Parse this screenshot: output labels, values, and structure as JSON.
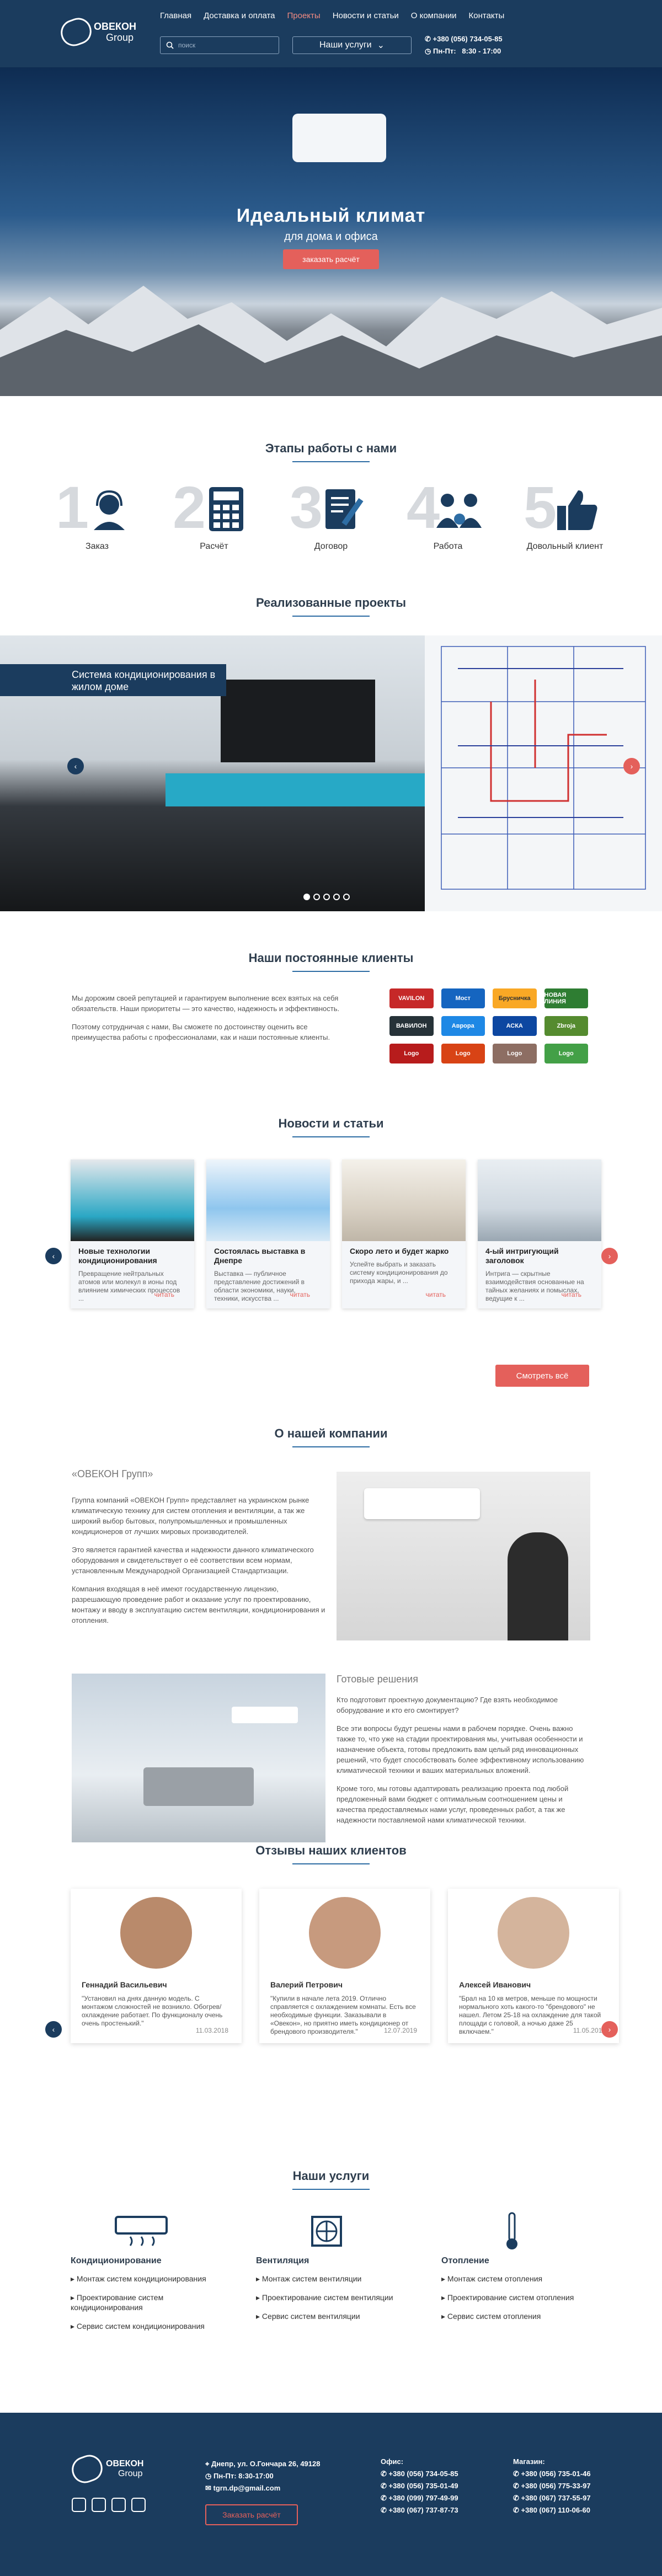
{
  "brand": {
    "name": "ОВЕКОН",
    "sub": "Group"
  },
  "nav": [
    "Главная",
    "Доставка и оплата",
    "Проекты",
    "Новости и статьи",
    "О компании",
    "Контакты"
  ],
  "nav_active": 2,
  "search": {
    "placeholder": "поиск"
  },
  "services_button": "Наши услуги",
  "contacts": {
    "phone": "+380 (056) 734-05-85",
    "hours_label": "Пн-Пт:",
    "hours": "8:30 - 17:00"
  },
  "hero": {
    "title": "Идеальный климат",
    "subtitle": "для дома и офиса",
    "cta": "заказать расчёт"
  },
  "stages": {
    "title": "Этапы работы с нами",
    "items": [
      {
        "num": "1",
        "label": "Заказ"
      },
      {
        "num": "2",
        "label": "Расчёт"
      },
      {
        "num": "3",
        "label": "Договор"
      },
      {
        "num": "4",
        "label": "Работа"
      },
      {
        "num": "5",
        "label": "Довольный клиент"
      }
    ]
  },
  "projects": {
    "title": "Реализованные проекты",
    "caption": "Система кондиционирования в жилом доме"
  },
  "clients": {
    "title": "Наши постоянные клиенты",
    "text1": "Мы дорожим своей репутацией и гарантируем выполнение всех взятых на себя обязательств. Наши приоритеты — это качество, надежность и эффективность.",
    "text2": "Поэтому сотрудничая с нами, Вы сможете по достоинству оценить все преимущества работы с профессионалами, как и наши постоянные клиенты.",
    "logos": [
      "VAVILON",
      "Мост",
      "Брусничка",
      "НОВАЯ ЛИНИЯ",
      "ВАВИЛОН",
      "Аврора",
      "АСКА",
      "Zbroja",
      "Logo",
      "Logo",
      "Logo",
      "Logo"
    ]
  },
  "news": {
    "title": "Новости и статьи",
    "more": "читать",
    "all": "Смотреть всё",
    "items": [
      {
        "title": "Новые технологии кондиционирования",
        "text": "Превращение нейтральных атомов или молекул в ионы под влиянием химических процессов ..."
      },
      {
        "title": "Состоялась выставка в Днепре",
        "text": "Выставка — публичное представление достижений в области экономики, науки, техники, искусства ..."
      },
      {
        "title": "Скоро лето и будет жарко",
        "text": "Успейте выбрать и заказать систему кондиционирования до прихода жары, и ..."
      },
      {
        "title": "4-ый интригующий заголовок",
        "text": "Интрига — скрытные взаимодействия основанные на тайных желаниях и помыслах, ведущие к ..."
      }
    ]
  },
  "about": {
    "title": "О нашей компании",
    "heading": "«ОВЕКОН Групп»",
    "p1": "Группа компаний «ОВЕКОН Групп» представляет на украинском рынке климатическую технику для систем отопления и вентиляции, а так же широкий выбор бытовых, полупромышленных и промышленных кондиционеров от лучших мировых производителей.",
    "p2": "Это является гарантией качества и надежности данного климатического оборудования и свидетельствует о её соответствии всем нормам, установленным Международной Организацией Стандартизации.",
    "p3": "Компания входящая в неё имеют государственную лицензию, разрешающую проведение работ и оказание услуг по проектированию, монтажу и вводу в эксплуатацию систем вентиляции, кондиционирования и отопления.",
    "ready_heading": "Готовые решения",
    "r1": "Кто подготовит проектную документацию? Где взять необходимое оборудование и кто его смонтирует?",
    "r2": "Все эти вопросы будут решены нами в рабочем порядке. Очень важно также то, что уже на стадии проектирования мы, учитывая особенности и назначение объекта, готовы предложить вам целый ряд инновационных решений, что будет способствовать более эффективному использованию климатической техники и ваших материальных вложений.",
    "r3": "Кроме того, мы готовы адаптировать реализацию проекта под любой предложенный вами бюджет с оптимальным соотношением цены и качества предоставляемых нами услуг, проведенных работ, а так же надежности поставляемой нами климатической техники."
  },
  "reviews": {
    "title": "Отзывы наших клиентов",
    "items": [
      {
        "name": "Геннадий Васильевич",
        "text": "\"Установил на днях данную модель. С монтажом сложностей не возникло. Обогрев/охлаждение работает. По функционалу очень очень простенький.\"",
        "date": "11.03.2018"
      },
      {
        "name": "Валерий Петрович",
        "text": "\"Купили в начале лета 2019. Отлично справляется с охлаждением комнаты. Есть все необходимые функции. Заказывали в «Овекон», но приятно иметь кондиционер от брендового производителя.\"",
        "date": "12.07.2019"
      },
      {
        "name": "Алексей Иванович",
        "text": "\"Брал на 10 кв метров, меньше по мощности нормального хоть какого-то \"брендового\" не нашел. Летом 25-18 на охлаждение для такой площади с головой, а ночью даже 25 включаем.\"",
        "date": "11.05.2019"
      }
    ]
  },
  "services": {
    "title": "Наши услуги",
    "items": [
      {
        "heading": "Кондиционирование",
        "list": [
          "Монтаж систем кондиционирования",
          "Проектирование систем кондиционирования",
          "Сервис систем кондиционирования"
        ]
      },
      {
        "heading": "Вентиляция",
        "list": [
          "Монтаж систем вентиляции",
          "Проектирование систем вентиляции",
          "Сервис систем вентиляции"
        ]
      },
      {
        "heading": "Отопление",
        "list": [
          "Монтаж систем отопления",
          "Проектирование систем отопления",
          "Сервис систем отопления"
        ]
      }
    ]
  },
  "footer": {
    "address": "Днепр, ул. О.Гончара 26, 49128",
    "hours": "Пн-Пт: 8:30-17:00",
    "email": "tgrn.dp@gmail.com",
    "cta": "Заказать расчёт",
    "office_label": "Офис:",
    "office_phones": [
      "+380 (056) 734-05-85",
      "+380 (056) 735-01-49",
      "+380 (099) 797-49-99",
      "+380 (067) 737-87-73"
    ],
    "shop_label": "Магазин:",
    "shop_phones": [
      "+380 (056) 735-01-46",
      "+380 (056) 775-33-97",
      "+380 (067) 737-55-97",
      "+380 (067) 110-06-60"
    ]
  },
  "colors": {
    "navy": "#1b3c5e",
    "accent": "#e4605b",
    "link": "#2e6da4"
  }
}
